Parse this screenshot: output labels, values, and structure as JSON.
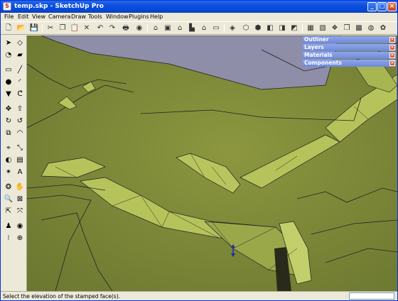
{
  "window": {
    "title": "temp.skp - SketchUp Pro"
  },
  "menu": [
    "File",
    "Edit",
    "View",
    "Camera",
    "Draw",
    "Tools",
    "Window",
    "Plugins",
    "Help"
  ],
  "panels": [
    "Outliner",
    "Layers",
    "Materials",
    "Components"
  ],
  "status": {
    "text": "Select the elevation of the stamped face(s)."
  },
  "colors": {
    "titlebar": "#0a4ee0",
    "terrain": "#7f8a3a",
    "panel": "#7a93e0",
    "sky_plane": "#8e8ea8"
  }
}
